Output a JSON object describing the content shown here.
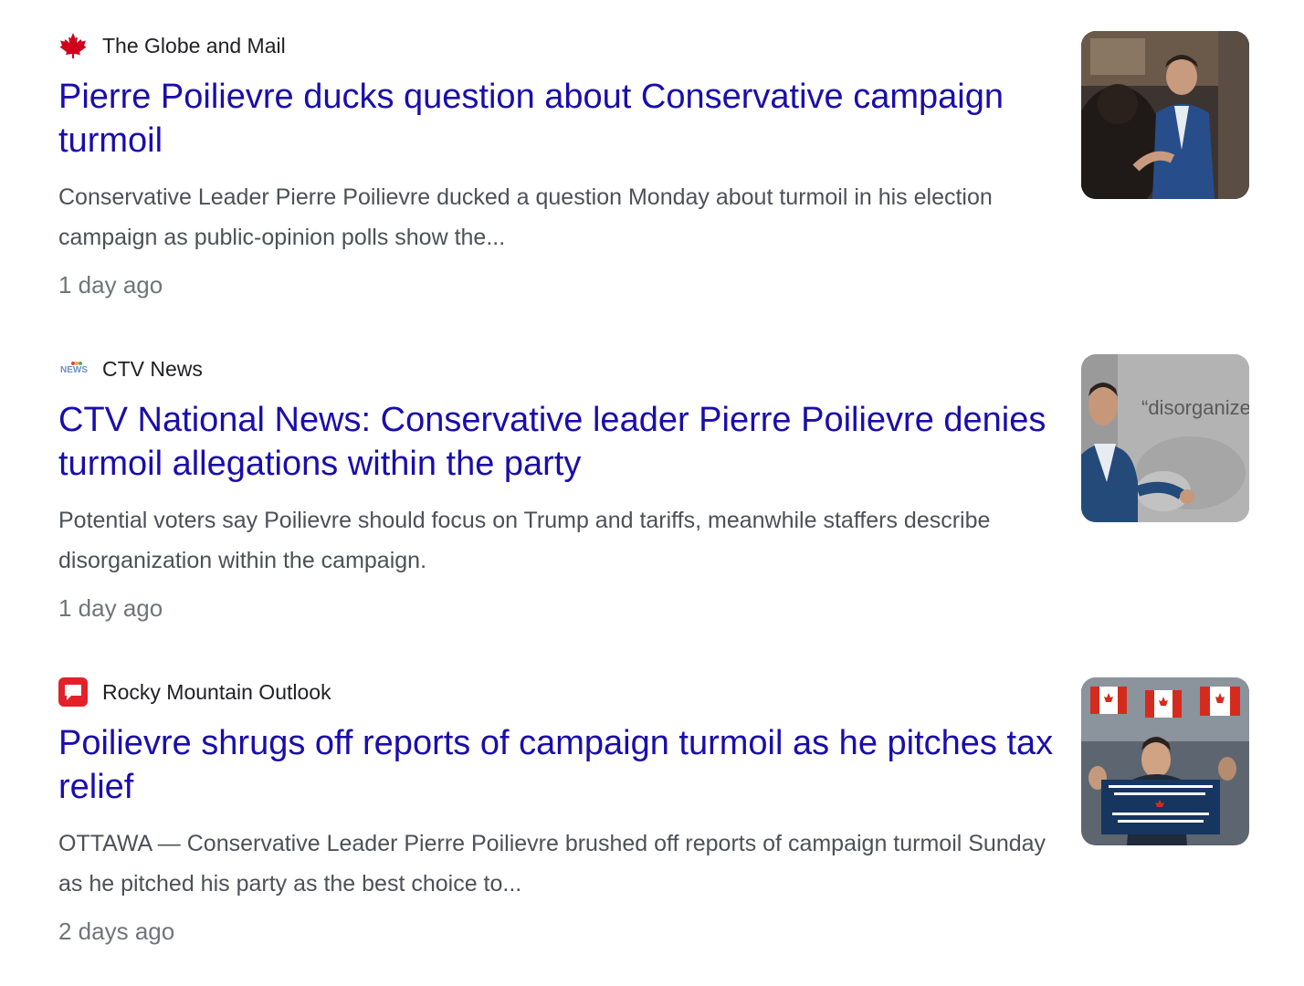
{
  "results": [
    {
      "source": "The Globe and Mail",
      "source_icon": "maple-leaf-icon",
      "headline": "Pierre Poilievre ducks question about Conservative campaign turmoil",
      "snippet": "Conservative Leader Pierre Poilievre ducked a question Monday about turmoil in his election campaign as public-opinion polls show the...",
      "time": "1 day ago"
    },
    {
      "source": "CTV News",
      "source_icon": "ctv-news-logo-icon",
      "headline": "CTV National News: Conservative leader Pierre Poilievre denies turmoil allegations within the party",
      "snippet": "Potential voters say Poilievre should focus on Trump and tariffs, meanwhile staffers describe disorganization within the campaign.",
      "time": "1 day ago",
      "thumbnail_caption": "“disorganize"
    },
    {
      "source": "Rocky Mountain Outlook",
      "source_icon": "speech-bubble-icon",
      "headline": "Poilievre shrugs off reports of campaign turmoil as he pitches tax relief",
      "snippet": "OTTAWA — Conservative Leader Pierre Poilievre brushed off reports of campaign turmoil Sunday as he pitched his party as the best choice to...",
      "time": "2 days ago"
    }
  ],
  "colors": {
    "headline": "#1a0dab",
    "snippet": "#4d5156",
    "time": "#70757a",
    "source": "#202124",
    "globe_red": "#d0021b",
    "rmo_red": "#e3212b"
  }
}
